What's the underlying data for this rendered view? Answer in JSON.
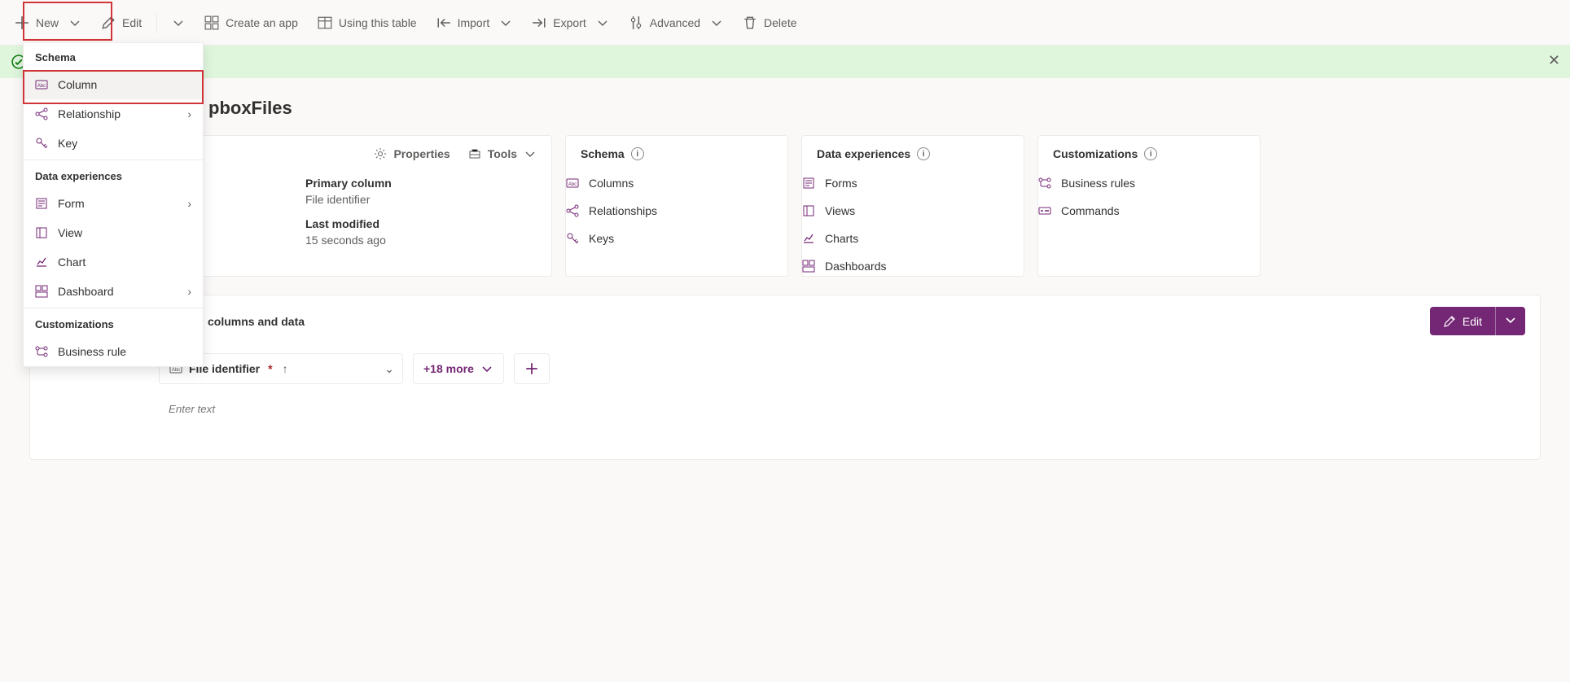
{
  "toolbar": {
    "new": "New",
    "edit": "Edit",
    "create_app": "Create an app",
    "using_table": "Using this table",
    "import": "Import",
    "export": "Export",
    "advanced": "Advanced",
    "delete": "Delete"
  },
  "dropdown": {
    "section_schema": "Schema",
    "column": "Column",
    "relationship": "Relationship",
    "key": "Key",
    "section_data_exp": "Data experiences",
    "form": "Form",
    "view": "View",
    "chart": "Chart",
    "dashboard": "Dashboard",
    "section_customizations": "Customizations",
    "business_rule": "Business rule"
  },
  "page": {
    "title_suffix": "pboxFiles"
  },
  "card_props": {
    "properties_btn": "Properties",
    "tools_btn": "Tools",
    "primary_col_lbl": "Primary column",
    "primary_col_val": "File identifier",
    "last_mod_lbl": "Last modified",
    "last_mod_val": "15 seconds ago"
  },
  "card_schema": {
    "title": "Schema",
    "columns": "Columns",
    "relationships": "Relationships",
    "keys": "Keys"
  },
  "card_data_exp": {
    "title": "Data experiences",
    "forms": "Forms",
    "views": "Views",
    "charts": "Charts",
    "dashboards": "Dashboards"
  },
  "card_customizations": {
    "title": "Customizations",
    "business_rules": "Business rules",
    "commands": "Commands"
  },
  "section2": {
    "title_suffix": "columns and data",
    "edit_btn": "Edit",
    "col_header": "File identifier",
    "more_label": "+18 more",
    "enter_placeholder": "Enter text"
  }
}
